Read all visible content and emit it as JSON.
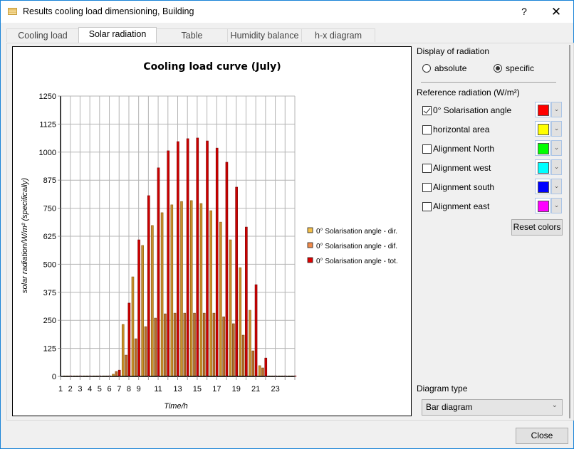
{
  "window": {
    "title": "Results cooling load dimensioning, Building",
    "help_label": "?",
    "close_label": "✕"
  },
  "tabs": [
    {
      "label": "Cooling load",
      "active": false
    },
    {
      "label": "Solar radiation",
      "active": true
    },
    {
      "label": "Table",
      "active": false
    },
    {
      "label": "Humidity balance",
      "active": false
    },
    {
      "label": "h-x diagram",
      "active": false
    }
  ],
  "right_panel": {
    "display_heading": "Display of radiation",
    "radio_absolute": "absolute",
    "radio_specific": "specific",
    "selected_display": "specific",
    "reference_heading": "Reference radiation (W/m²)",
    "references": [
      {
        "label": "0° Solarisation angle",
        "checked": true,
        "color": "#ff0000"
      },
      {
        "label": "horizontal area",
        "checked": false,
        "color": "#ffff00"
      },
      {
        "label": "Alignment North",
        "checked": false,
        "color": "#00ff00"
      },
      {
        "label": "Alignment west",
        "checked": false,
        "color": "#00ffff"
      },
      {
        "label": "Alignment south",
        "checked": false,
        "color": "#0000ff"
      },
      {
        "label": "Alignment east",
        "checked": false,
        "color": "#ff00ff"
      }
    ],
    "reset_colors_label": "Reset colors",
    "diagram_type_heading": "Diagram type",
    "diagram_type_value": "Bar diagram"
  },
  "footer": {
    "close_label": "Close"
  },
  "chart_data": {
    "type": "bar",
    "title": "Cooling load curve (July)",
    "xlabel": "Time/h",
    "ylabel": "solar radiation/W/m² (specifically)",
    "ylim": [
      0,
      1250
    ],
    "yticks": [
      0,
      125,
      250,
      375,
      500,
      625,
      750,
      875,
      1000,
      1125,
      1250
    ],
    "categories": [
      1,
      2,
      3,
      4,
      5,
      6,
      7,
      8,
      9,
      10,
      11,
      12,
      13,
      14,
      15,
      16,
      17,
      18,
      19,
      20,
      21,
      22,
      23,
      24
    ],
    "xtick_labels": [
      "1",
      "2",
      "3",
      "4",
      "5",
      "6",
      "7",
      "8",
      "9",
      "11",
      "13",
      "15",
      "17",
      "19",
      "21",
      "23"
    ],
    "grid": true,
    "legend_position": "right",
    "series": [
      {
        "name": "0° Solarisation angle - dir.",
        "color": "#c8902a",
        "values": [
          0,
          0,
          0,
          0,
          0,
          10,
          232,
          444,
          584,
          673,
          730,
          765,
          780,
          784,
          771,
          739,
          688,
          609,
          485,
          295,
          48,
          0,
          0,
          0
        ]
      },
      {
        "name": "0° Solarisation angle - dif.",
        "color": "#c0702a",
        "values": [
          0,
          0,
          0,
          0,
          0,
          22,
          95,
          168,
          222,
          260,
          279,
          282,
          282,
          282,
          282,
          282,
          266,
          235,
          184,
          114,
          38,
          0,
          0,
          0
        ]
      },
      {
        "name": "0° Solarisation angle - tot.",
        "color": "#cc0000",
        "values": [
          0,
          0,
          0,
          0,
          0,
          28,
          327,
          609,
          806,
          930,
          1006,
          1047,
          1060,
          1063,
          1050,
          1018,
          955,
          844,
          666,
          409,
          82,
          0,
          0,
          0
        ]
      }
    ]
  }
}
